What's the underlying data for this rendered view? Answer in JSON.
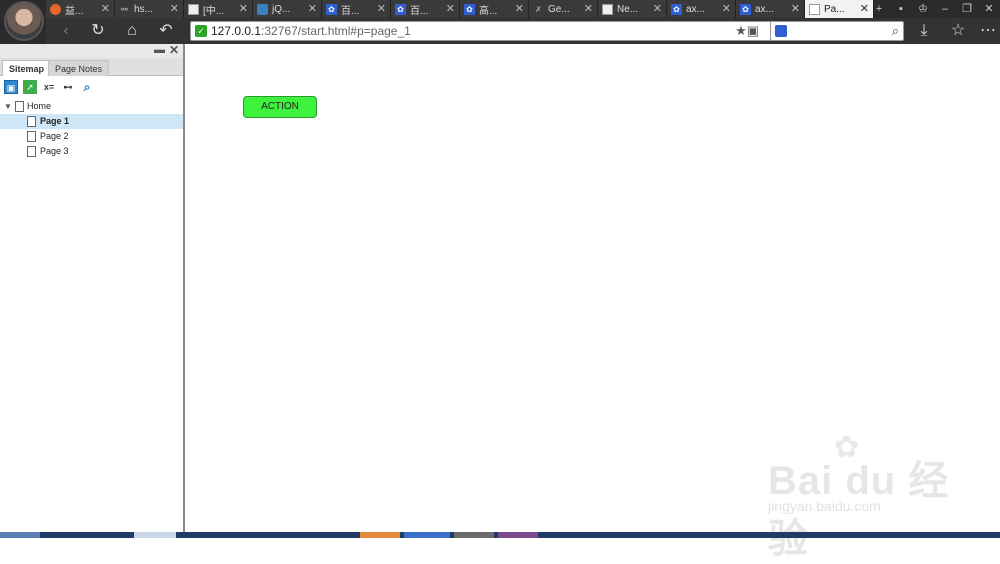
{
  "browser": {
    "tabs": [
      {
        "label": "益...",
        "favicon": "orange-circle-icon",
        "active": false
      },
      {
        "label": "hs...",
        "favicon": "link-icon",
        "active": false
      },
      {
        "label": "[中...",
        "favicon": "page-icon",
        "active": false
      },
      {
        "label": "jQ...",
        "favicon": "jquery-icon",
        "active": false
      },
      {
        "label": "百...",
        "favicon": "baidu-paw-icon",
        "active": false
      },
      {
        "label": "百...",
        "favicon": "baidu-paw-icon",
        "active": false
      },
      {
        "label": "高...",
        "favicon": "baidu-paw-icon",
        "active": false
      },
      {
        "label": "Ge...",
        "favicon": "x-mark-icon",
        "active": false
      },
      {
        "label": "Ne...",
        "favicon": "page-icon",
        "active": false
      },
      {
        "label": "ax...",
        "favicon": "baidu-paw-icon",
        "active": false
      },
      {
        "label": "ax...",
        "favicon": "baidu-paw-icon",
        "active": false
      },
      {
        "label": "Pa...",
        "favicon": "page-icon",
        "active": true
      }
    ],
    "url": {
      "host": "127.0.0.1",
      "rest": ":32767/start.html#p=page_1"
    }
  },
  "sidebar": {
    "tabs": [
      "Sitemap",
      "Page Notes"
    ],
    "tools": {
      "vars": "x=",
      "link": "⊷"
    },
    "tree": {
      "root": "Home",
      "pages": [
        "Page 1",
        "Page 2",
        "Page 3"
      ],
      "selected": "Page 1"
    }
  },
  "page": {
    "action_button": "ACTION",
    "action_color": "#3ef33e"
  },
  "watermark": {
    "brand": "Bai du 经验",
    "sub": "jingyan.baidu.com"
  }
}
